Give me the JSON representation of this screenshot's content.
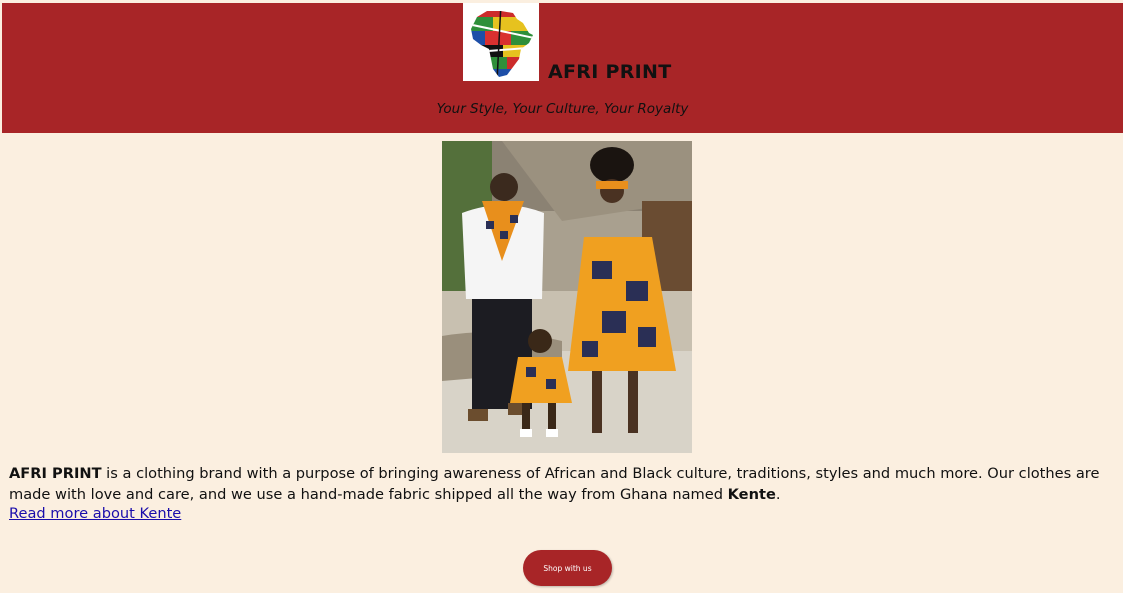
{
  "header": {
    "brand": "AFRI PRINT",
    "tagline": "Your Style, Your Culture, Your Royalty",
    "logo_icon": "africa-flags-map-icon",
    "background": "#a82527"
  },
  "hero": {
    "image_icon": "family-in-kente-print-photo"
  },
  "about": {
    "brand_bold": "AFRI PRINT",
    "text": " is a clothing brand with a purpose of bringing awareness of African and Black culture, traditions, styles and much more. Our clothes are made with love and care, and we use a hand-made fabric shipped all the way from Ghana named ",
    "fabric_bold": "Kente",
    "end": ".",
    "link_text": "Read more about Kente"
  },
  "cta": {
    "shop_label": "Shop with us"
  },
  "colors": {
    "page_bg": "#fbefe0",
    "accent": "#a82527",
    "link": "#1a0dab"
  }
}
